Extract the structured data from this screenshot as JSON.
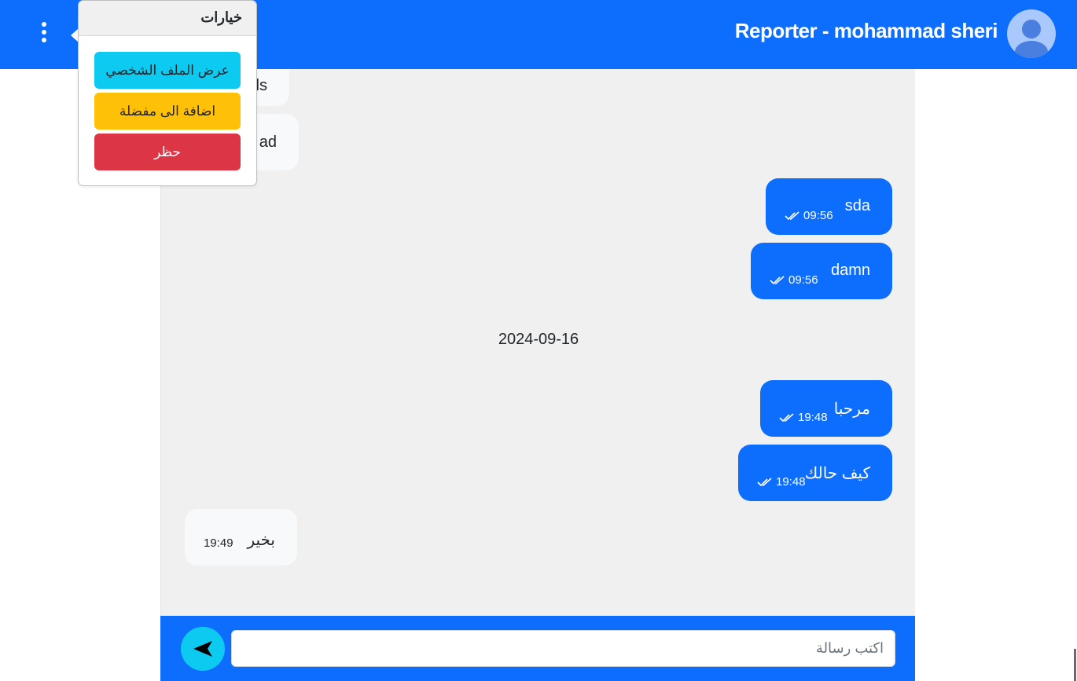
{
  "header": {
    "title": "Reporter - mohammad sheri",
    "avatar_icon": "user-avatar-icon",
    "menu_icon": "kebab-menu-icon",
    "bg_color": "#0d6efd"
  },
  "popover": {
    "title": "خيارات",
    "buttons": [
      {
        "label": "عرض الملف الشخصي",
        "color": "#0dcaf0"
      },
      {
        "label": "اضافة الى مفضلة",
        "color": "#ffc107"
      },
      {
        "label": "حظر",
        "color": "#dc3545"
      }
    ]
  },
  "messages": [
    {
      "direction": "in",
      "text": "ls",
      "time": ""
    },
    {
      "direction": "in",
      "text": "ad",
      "time": ""
    },
    {
      "direction": "out",
      "text": "sda",
      "time": "09:56",
      "read": true
    },
    {
      "direction": "out",
      "text": "damn",
      "time": "09:56",
      "read": true
    },
    {
      "direction": "out",
      "text": "مرحبا",
      "time": "19:48",
      "read": true
    },
    {
      "direction": "out",
      "text": "كيف حالك",
      "time": "19:48",
      "read": true
    },
    {
      "direction": "in",
      "text": "بخير",
      "time": "19:49"
    }
  ],
  "date_separator": "2024-09-16",
  "composer": {
    "placeholder": "اكتب رسالة",
    "send_icon": "send-icon"
  }
}
